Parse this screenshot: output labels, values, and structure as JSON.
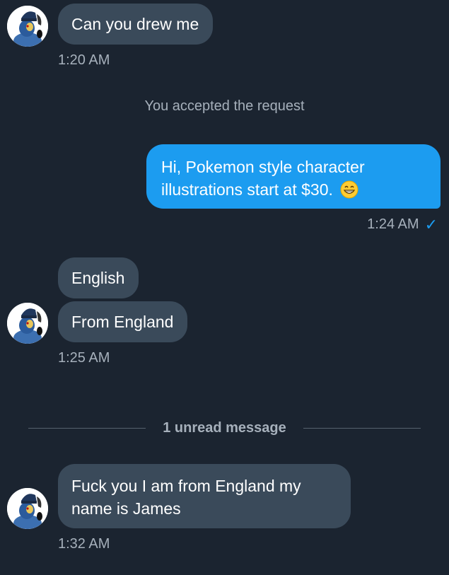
{
  "conversation": {
    "messages": [
      {
        "text": "Can you drew me",
        "time": "1:20 AM"
      },
      {
        "system": "You accepted the request"
      },
      {
        "line1": "Hi, Pokemon style character",
        "line2": "illustrations start at $30.",
        "emoji": "grinning-face-emoji",
        "time": "1:24 AM"
      },
      {
        "text_a": "English",
        "text_b": "From England",
        "time": "1:25 AM"
      },
      {
        "divider": "1 unread message"
      },
      {
        "line1": "Fuck you I am from England my",
        "line2": "name is James",
        "time": "1:32 AM"
      }
    ],
    "colors": {
      "background": "#1b2430",
      "incoming_bubble": "#3a4a5a",
      "outgoing_bubble": "#1c9cf0",
      "secondary_text": "#a6b0bb"
    },
    "avatar_icon": "lucario-avatar-icon",
    "read_icon": "checkmark-icon"
  }
}
